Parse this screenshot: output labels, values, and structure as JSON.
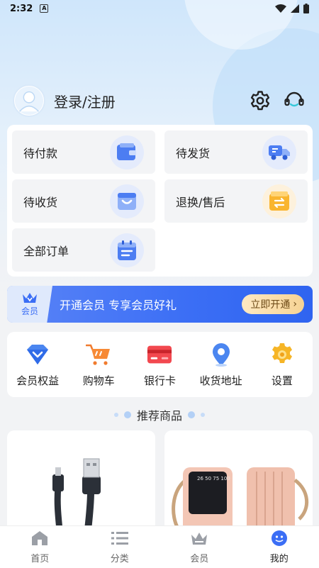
{
  "status_bar": {
    "time": "2:32",
    "notif_letter": "A"
  },
  "header": {
    "login_text": "登录/注册"
  },
  "orders": [
    {
      "label": "待付款",
      "icon": "wallet-icon",
      "color": "#3f72f0"
    },
    {
      "label": "待发货",
      "icon": "truck-icon",
      "color": "#3f72f0"
    },
    {
      "label": "待收货",
      "icon": "box-icon",
      "color": "#3f72f0"
    },
    {
      "label": "退换/售后",
      "icon": "exchange-icon",
      "color": "#f7b733"
    },
    {
      "label": "全部订单",
      "icon": "calendar-list-icon",
      "color": "#3f72f0"
    }
  ],
  "member_banner": {
    "badge": "会员",
    "text": "开通会员 专享会员好礼",
    "button": "立即开通"
  },
  "tools": [
    {
      "label": "会员权益",
      "icon": "diamond-icon"
    },
    {
      "label": "购物车",
      "icon": "cart-icon"
    },
    {
      "label": "银行卡",
      "icon": "bank-card-icon"
    },
    {
      "label": "收货地址",
      "icon": "location-icon"
    },
    {
      "label": "设置",
      "icon": "settings-gear-icon"
    }
  ],
  "recommend": {
    "title": "推荐商品"
  },
  "tabbar": [
    {
      "label": "首页",
      "icon": "home-icon",
      "active": false
    },
    {
      "label": "分类",
      "icon": "category-list-icon",
      "active": false
    },
    {
      "label": "会员",
      "icon": "crown-icon",
      "active": false
    },
    {
      "label": "我的",
      "icon": "smiley-icon",
      "active": true
    }
  ],
  "colors": {
    "accent": "#3b6ef5",
    "gold": "#f6d394",
    "background": "#f2f3f5"
  }
}
